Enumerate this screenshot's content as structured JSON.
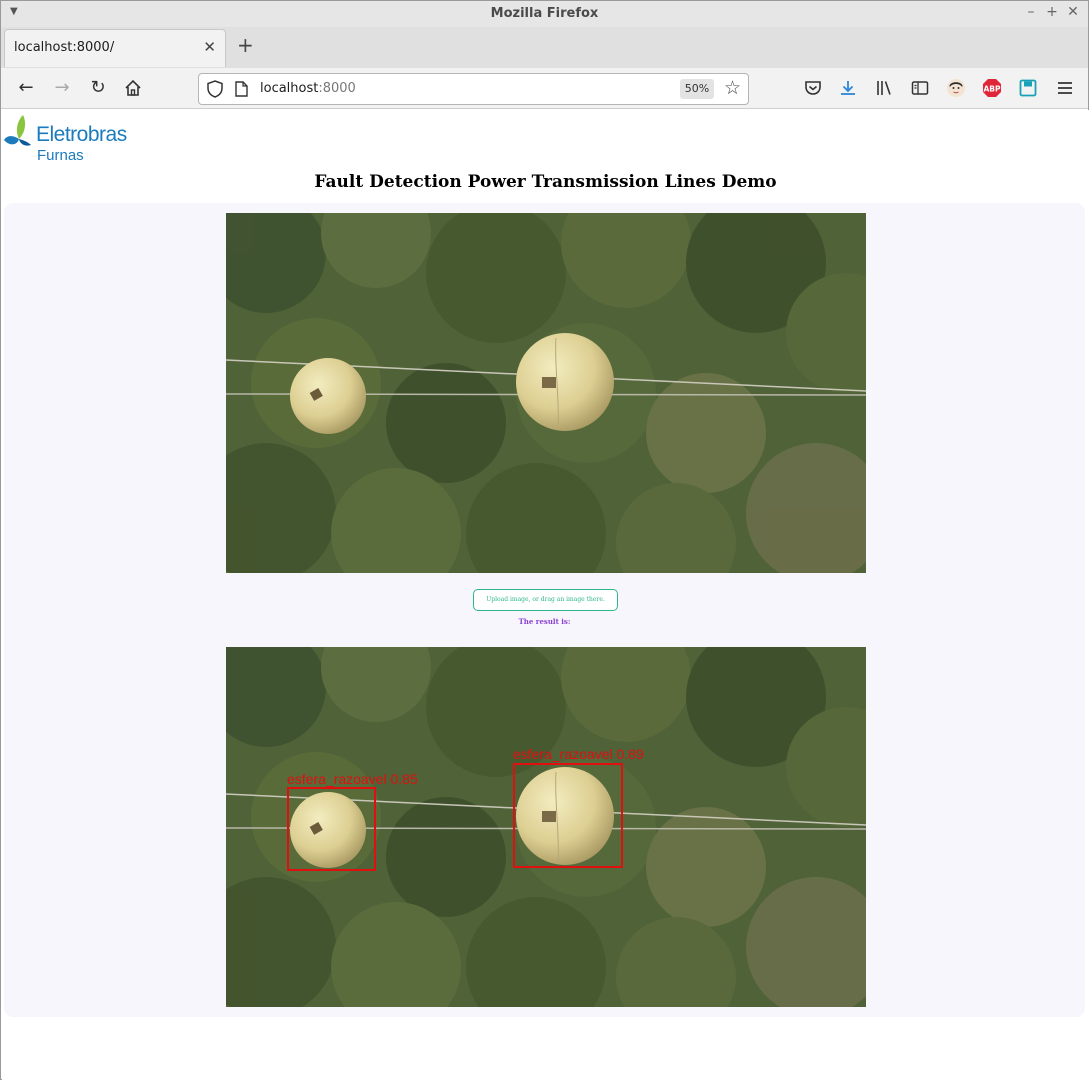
{
  "browser": {
    "window_title": "Mozilla Firefox",
    "tab_title": "localhost:8000/",
    "url_host": "localhost",
    "url_port": ":8000",
    "zoom": "50%"
  },
  "page": {
    "logo_brand": "Eletrobras",
    "logo_sub": "Furnas",
    "title": "Fault Detection Power Transmission Lines Demo",
    "upload_label": "Upload image, or drag an image there.",
    "result_label": "The result is:"
  },
  "detections": [
    {
      "label": "esfera_razoavel 0.85"
    },
    {
      "label": "esfera_razoavel 0.89"
    }
  ],
  "colors": {
    "brand_blue": "#1b7bbd",
    "upload_green": "#2fb88a",
    "result_purple": "#8a3fd1",
    "detection_red": "#e01010",
    "panel_bg": "#f8f6fd"
  }
}
